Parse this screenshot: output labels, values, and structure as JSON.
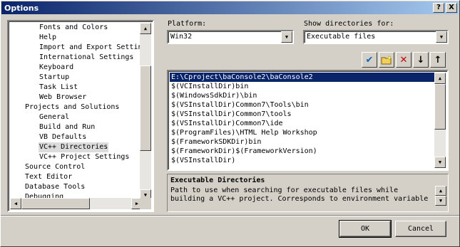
{
  "window": {
    "title": "Options",
    "help_glyph": "?",
    "close_glyph": "X"
  },
  "tree": {
    "items": [
      {
        "label": "Fonts and Colors"
      },
      {
        "label": "Help"
      },
      {
        "label": "Import and Export Settin"
      },
      {
        "label": "International Settings"
      },
      {
        "label": "Keyboard"
      },
      {
        "label": "Startup"
      },
      {
        "label": "Task List"
      },
      {
        "label": "Web Browser"
      },
      {
        "label": "Projects and Solutions"
      },
      {
        "label": "General"
      },
      {
        "label": "Build and Run"
      },
      {
        "label": "VB Defaults"
      },
      {
        "label": "VC++ Directories"
      },
      {
        "label": "VC++ Project Settings"
      },
      {
        "label": "Source Control"
      },
      {
        "label": "Text Editor"
      },
      {
        "label": "Database Tools"
      },
      {
        "label": "Debugging"
      }
    ],
    "selected_index": 12
  },
  "platform": {
    "label": "Platform:",
    "value": "Win32"
  },
  "show_dirs": {
    "label": "Show directories for:",
    "value": "Executable files"
  },
  "toolbar": {
    "check_glyph": "✔",
    "delete_glyph": "✕",
    "down_glyph": "↓",
    "up_glyph": "↑"
  },
  "directories": {
    "items": [
      "E:\\Cproject\\baConsole2\\baConsole2",
      "$(VCInstallDir)bin",
      "$(WindowsSdkDir)\\bin",
      "$(VSInstallDir)Common7\\Tools\\bin",
      "$(VSInstallDir)Common7\\tools",
      "$(VSInstallDir)Common7\\ide",
      "$(ProgramFiles)\\HTML Help Workshop",
      "$(FrameworkSDKDir)bin",
      "$(FrameworkDir)$(FrameworkVersion)",
      "$(VSInstallDir)"
    ],
    "selected_index": 0
  },
  "description": {
    "title": "Executable Directories",
    "text": "Path to use when searching for executable files while building a VC++ project.  Corresponds to environment variable"
  },
  "buttons": {
    "ok": "OK",
    "cancel": "Cancel"
  },
  "scroll_glyphs": {
    "up": "▲",
    "down": "▼",
    "left": "◀",
    "right": "▶"
  }
}
